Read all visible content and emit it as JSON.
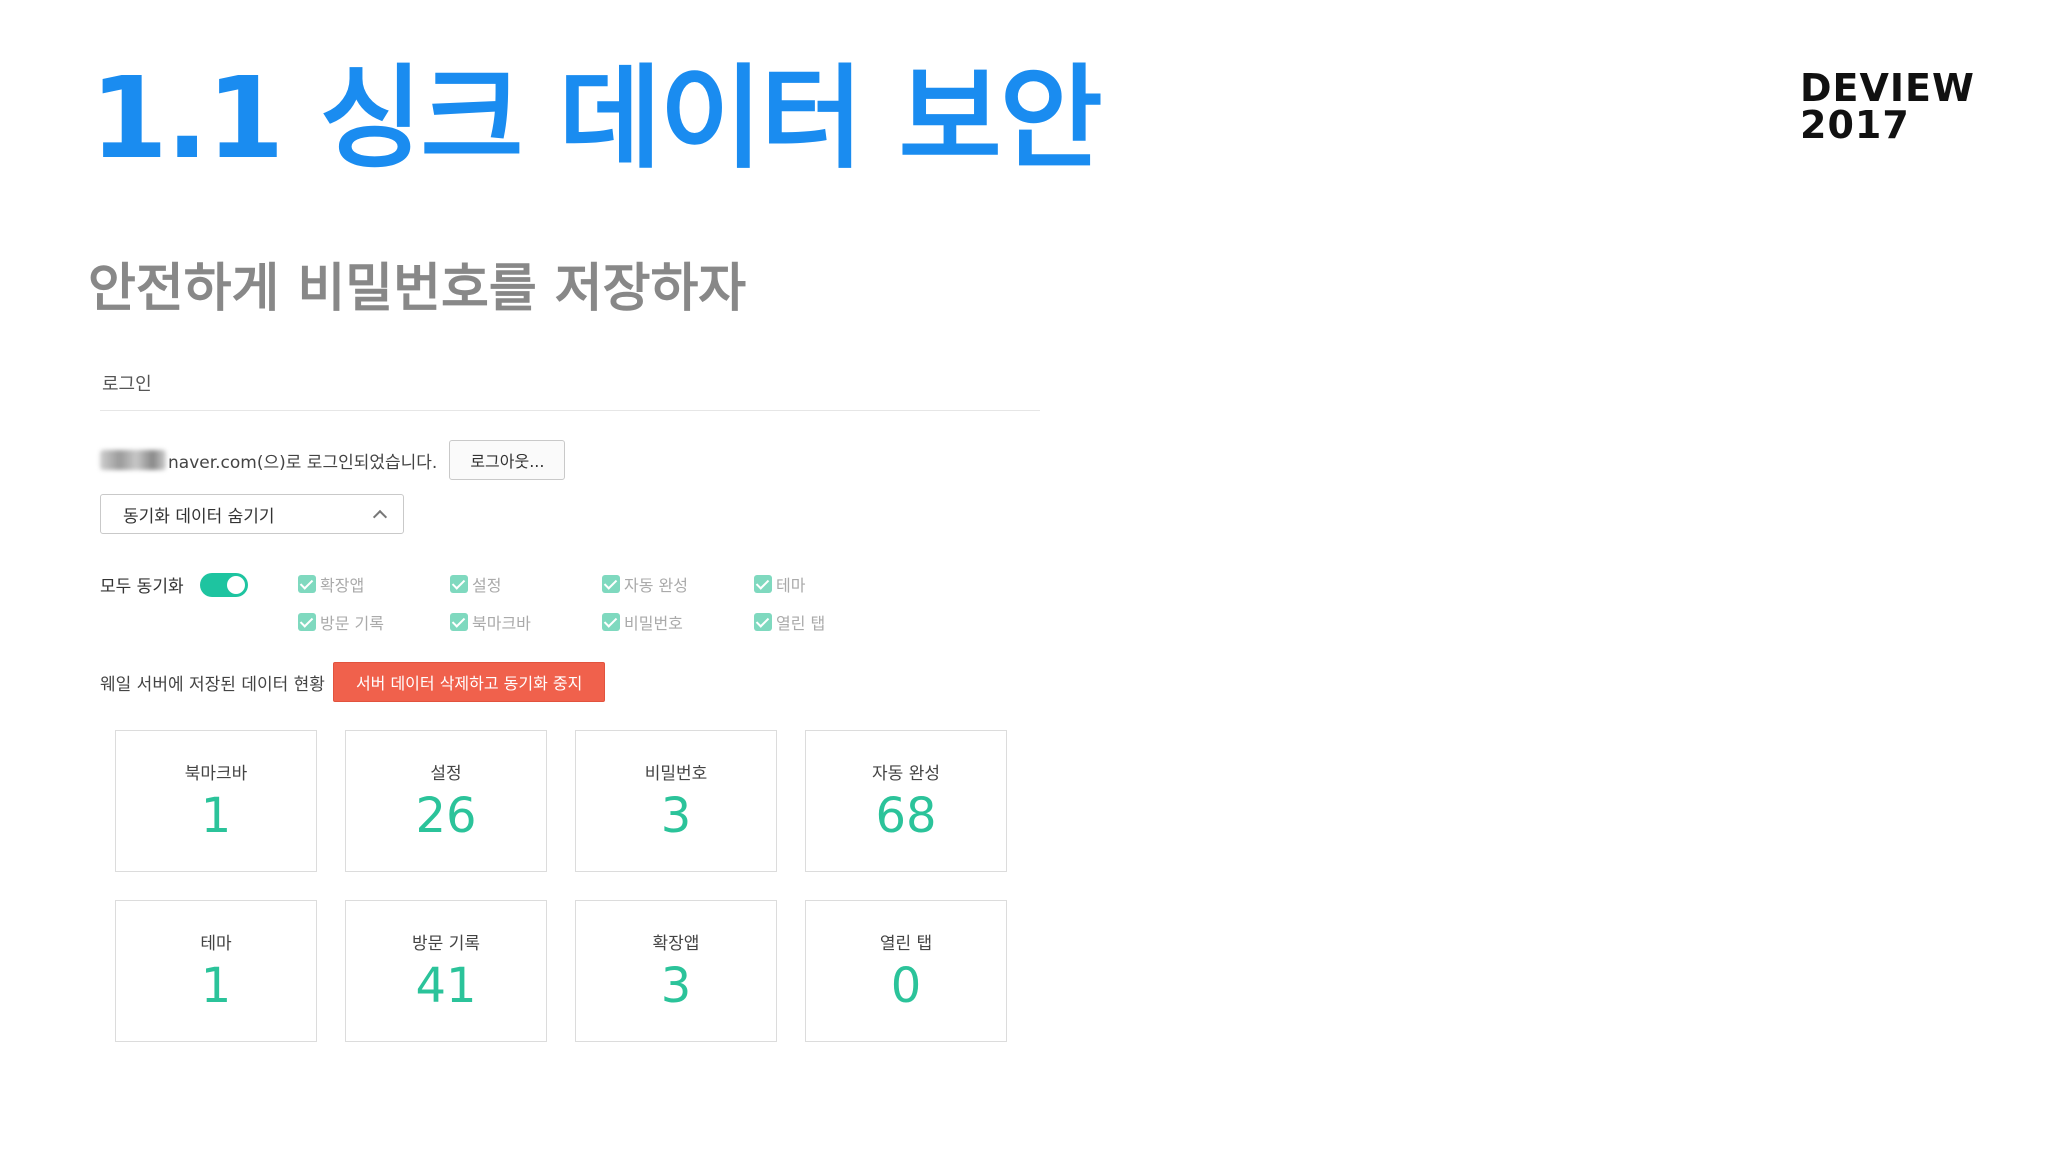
{
  "slide": {
    "title": "1.1 싱크 데이터 보안",
    "brand_line1": "DEVIEW",
    "brand_line2": "2017",
    "subtitle": "안전하게 비밀번호를 저장하자"
  },
  "login": {
    "section_title": "로그인",
    "account_text": "naver.com(으)로 로그인되었습니다.",
    "logout_label": "로그아웃...",
    "hide_data_label": "동기화 데이터 숨기기"
  },
  "sync": {
    "sync_all_label": "모두 동기화",
    "sync_all_on": true,
    "items": [
      {
        "label": "확장앱",
        "checked": true
      },
      {
        "label": "설정",
        "checked": true
      },
      {
        "label": "자동 완성",
        "checked": true
      },
      {
        "label": "테마",
        "checked": true
      },
      {
        "label": "방문 기록",
        "checked": true
      },
      {
        "label": "북마크바",
        "checked": true
      },
      {
        "label": "비밀번호",
        "checked": true
      },
      {
        "label": "열린 탭",
        "checked": true
      }
    ]
  },
  "server": {
    "label": "웨일 서버에 저장된 데이터 현황",
    "delete_label": "서버 데이터 삭제하고 동기화 중지"
  },
  "stats": [
    {
      "label": "북마크바",
      "value": "1"
    },
    {
      "label": "설정",
      "value": "26"
    },
    {
      "label": "비밀번호",
      "value": "3"
    },
    {
      "label": "자동 완성",
      "value": "68"
    },
    {
      "label": "테마",
      "value": "1"
    },
    {
      "label": "방문 기록",
      "value": "41"
    },
    {
      "label": "확장앱",
      "value": "3"
    },
    {
      "label": "열린 탭",
      "value": "0"
    }
  ],
  "colors": {
    "title": "#1a8cf0",
    "accent_green": "#2bc39a",
    "danger": "#f0614c"
  }
}
